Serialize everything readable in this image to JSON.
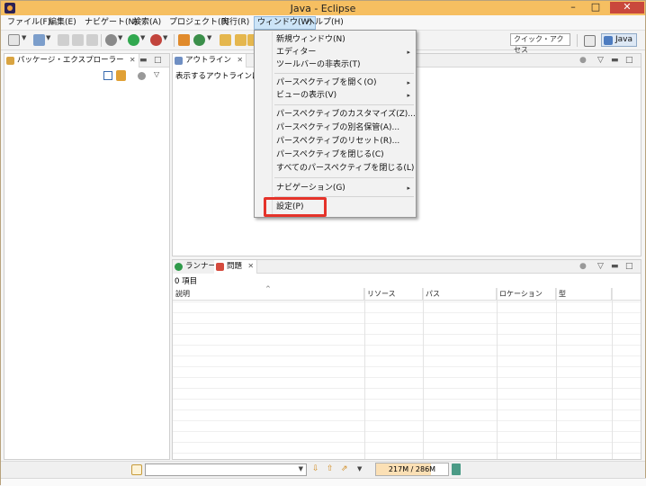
{
  "window": {
    "title": "Java - Eclipse",
    "minimize": "–",
    "maximize": "□",
    "close": "✕"
  },
  "menubar": [
    {
      "label": "ファイル(F)"
    },
    {
      "label": "編集(E)"
    },
    {
      "label": "ナビゲート(N)"
    },
    {
      "label": "検索(A)"
    },
    {
      "label": "プロジェクト(P)"
    },
    {
      "label": "実行(R)"
    },
    {
      "label": "ウィンドウ(W)"
    },
    {
      "label": "ヘルプ(H)"
    }
  ],
  "toolbar": {
    "quick_access": "クイック・アクセス",
    "perspective": "Java"
  },
  "colors": {
    "title_bar": "#f6bf61",
    "close_button": "#c9483c",
    "highlight": "#e5332a",
    "menu_active": "#cce4f7"
  },
  "panels": {
    "package_explorer": {
      "tab": "パッケージ・エクスプローラー"
    },
    "outline": {
      "tab": "アウトライン",
      "message": "表示するアウトラインはあり"
    },
    "bottom": {
      "tab_runner": "ランナー",
      "tab_problems": "問題",
      "count": "0 項目",
      "columns": [
        "説明",
        "リソース",
        "パス",
        "ロケーション",
        "型"
      ]
    }
  },
  "window_menu": {
    "items": [
      {
        "label": "新規ウィンドウ(N)",
        "submenu": false
      },
      {
        "label": "エディター",
        "submenu": true
      },
      {
        "label": "ツールバーの非表示(T)",
        "submenu": false
      },
      {
        "label": "パースペクティブを開く(O)",
        "submenu": true
      },
      {
        "label": "ビューの表示(V)",
        "submenu": true
      },
      {
        "label": "パースペクティブのカスタマイズ(Z)...",
        "submenu": false
      },
      {
        "label": "パースペクティブの別名保管(A)...",
        "submenu": false
      },
      {
        "label": "パースペクティブのリセット(R)...",
        "submenu": false
      },
      {
        "label": "パースペクティブを閉じる(C)",
        "submenu": false
      },
      {
        "label": "すべてのパースペクティブを閉じる(L)",
        "submenu": false
      },
      {
        "label": "ナビゲーション(G)",
        "submenu": true
      },
      {
        "label": "設定(P)",
        "submenu": false
      }
    ],
    "submenu_arrow": "▸"
  },
  "status": {
    "heap_used": "217M",
    "heap_sep": "/",
    "heap_total": "286M",
    "heap_fraction": 0.76
  }
}
